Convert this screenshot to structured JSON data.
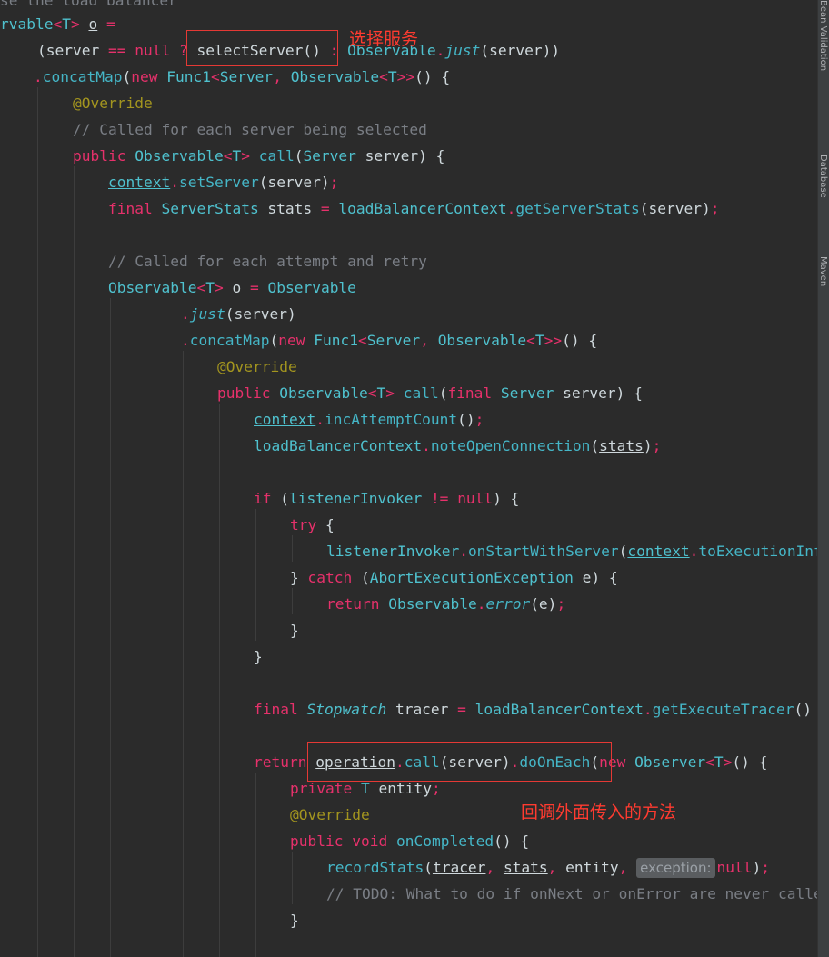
{
  "code_lines": [
    [
      [
        "cmt",
        "se the load balancer"
      ]
    ],
    [
      [
        "type",
        "rvable"
      ],
      [
        "op",
        "<"
      ],
      [
        "type",
        "T"
      ],
      [
        "op",
        ">"
      ],
      [
        "punct",
        " "
      ],
      [
        "ul",
        "o"
      ],
      [
        "punct",
        " "
      ],
      [
        "op",
        "="
      ]
    ],
    [
      [
        "punct",
        "(server "
      ],
      [
        "op",
        "=="
      ],
      [
        "punct",
        " "
      ],
      [
        "kw",
        "null"
      ],
      [
        "punct",
        " "
      ],
      [
        "op",
        "?"
      ],
      [
        "punct",
        " selectServer() "
      ],
      [
        "op",
        ":"
      ],
      [
        "punct",
        " "
      ],
      [
        "type",
        "Observable"
      ],
      [
        "op",
        "."
      ],
      [
        "ital",
        "just"
      ],
      [
        "punct",
        "(server))"
      ]
    ],
    [
      [
        "op",
        "."
      ],
      [
        "method",
        "concatMap"
      ],
      [
        "punct",
        "("
      ],
      [
        "kw",
        "new"
      ],
      [
        "punct",
        " "
      ],
      [
        "type",
        "Func1"
      ],
      [
        "op",
        "<"
      ],
      [
        "type",
        "Server"
      ],
      [
        "op",
        ","
      ],
      [
        "punct",
        " "
      ],
      [
        "type",
        "Observable"
      ],
      [
        "op",
        "<"
      ],
      [
        "type",
        "T"
      ],
      [
        "op",
        ">>"
      ],
      [
        "punct",
        "() {"
      ]
    ],
    [
      [
        "ann",
        "@Override"
      ]
    ],
    [
      [
        "cmt",
        "// Called for each server being selected"
      ]
    ],
    [
      [
        "kw",
        "public"
      ],
      [
        "punct",
        " "
      ],
      [
        "type",
        "Observable"
      ],
      [
        "op",
        "<"
      ],
      [
        "type",
        "T"
      ],
      [
        "op",
        ">"
      ],
      [
        "punct",
        " "
      ],
      [
        "method",
        "call"
      ],
      [
        "punct",
        "("
      ],
      [
        "type",
        "Server"
      ],
      [
        "punct",
        " server) {"
      ]
    ],
    [
      [
        "ulfield",
        "context"
      ],
      [
        "op",
        "."
      ],
      [
        "method",
        "setServer"
      ],
      [
        "punct",
        "(server)"
      ],
      [
        "op",
        ";"
      ]
    ],
    [
      [
        "kw",
        "final"
      ],
      [
        "punct",
        " "
      ],
      [
        "type",
        "ServerStats"
      ],
      [
        "punct",
        " stats "
      ],
      [
        "op",
        "="
      ],
      [
        "punct",
        " "
      ],
      [
        "field",
        "loadBalancerContext"
      ],
      [
        "op",
        "."
      ],
      [
        "method",
        "getServerStats"
      ],
      [
        "punct",
        "(server)"
      ],
      [
        "op",
        ";"
      ]
    ],
    [],
    [
      [
        "cmt",
        "// Called for each attempt and retry"
      ]
    ],
    [
      [
        "type",
        "Observable"
      ],
      [
        "op",
        "<"
      ],
      [
        "type",
        "T"
      ],
      [
        "op",
        ">"
      ],
      [
        "punct",
        " "
      ],
      [
        "ul",
        "o"
      ],
      [
        "punct",
        " "
      ],
      [
        "op",
        "="
      ],
      [
        "punct",
        " "
      ],
      [
        "type",
        "Observable"
      ]
    ],
    [
      [
        "op",
        "."
      ],
      [
        "ital",
        "just"
      ],
      [
        "punct",
        "(server)"
      ]
    ],
    [
      [
        "op",
        "."
      ],
      [
        "method",
        "concatMap"
      ],
      [
        "punct",
        "("
      ],
      [
        "kw",
        "new"
      ],
      [
        "punct",
        " "
      ],
      [
        "type",
        "Func1"
      ],
      [
        "op",
        "<"
      ],
      [
        "type",
        "Server"
      ],
      [
        "op",
        ","
      ],
      [
        "punct",
        " "
      ],
      [
        "type",
        "Observable"
      ],
      [
        "op",
        "<"
      ],
      [
        "type",
        "T"
      ],
      [
        "op",
        ">>"
      ],
      [
        "punct",
        "() {"
      ]
    ],
    [
      [
        "ann",
        "@Override"
      ]
    ],
    [
      [
        "kw",
        "public"
      ],
      [
        "punct",
        " "
      ],
      [
        "type",
        "Observable"
      ],
      [
        "op",
        "<"
      ],
      [
        "type",
        "T"
      ],
      [
        "op",
        ">"
      ],
      [
        "punct",
        " "
      ],
      [
        "method",
        "call"
      ],
      [
        "punct",
        "("
      ],
      [
        "kw",
        "final"
      ],
      [
        "punct",
        " "
      ],
      [
        "type",
        "Server"
      ],
      [
        "punct",
        " server) {"
      ]
    ],
    [
      [
        "ulfield",
        "context"
      ],
      [
        "op",
        "."
      ],
      [
        "method",
        "incAttemptCount"
      ],
      [
        "punct",
        "()"
      ],
      [
        "op",
        ";"
      ]
    ],
    [
      [
        "field",
        "loadBalancerContext"
      ],
      [
        "op",
        "."
      ],
      [
        "method",
        "noteOpenConnection"
      ],
      [
        "punct",
        "("
      ],
      [
        "ul",
        "stats"
      ],
      [
        "punct",
        ")"
      ],
      [
        "op",
        ";"
      ]
    ],
    [],
    [
      [
        "kw",
        "if"
      ],
      [
        "punct",
        " ("
      ],
      [
        "field",
        "listenerInvoker"
      ],
      [
        "punct",
        " "
      ],
      [
        "op",
        "!="
      ],
      [
        "punct",
        " "
      ],
      [
        "kw",
        "null"
      ],
      [
        "punct",
        ") {"
      ]
    ],
    [
      [
        "kw",
        "try"
      ],
      [
        "punct",
        " {"
      ]
    ],
    [
      [
        "field",
        "listenerInvoker"
      ],
      [
        "op",
        "."
      ],
      [
        "method",
        "onStartWithServer"
      ],
      [
        "punct",
        "("
      ],
      [
        "ulfield",
        "context"
      ],
      [
        "op",
        "."
      ],
      [
        "method",
        "toExecutionInfo"
      ]
    ],
    [
      [
        "punct",
        "} "
      ],
      [
        "kw",
        "catch"
      ],
      [
        "punct",
        " ("
      ],
      [
        "type",
        "AbortExecutionException"
      ],
      [
        "punct",
        " e) {"
      ]
    ],
    [
      [
        "kw",
        "return"
      ],
      [
        "punct",
        " "
      ],
      [
        "type",
        "Observable"
      ],
      [
        "op",
        "."
      ],
      [
        "ital",
        "error"
      ],
      [
        "punct",
        "(e)"
      ],
      [
        "op",
        ";"
      ]
    ],
    [
      [
        "punct",
        "}"
      ]
    ],
    [
      [
        "punct",
        "}"
      ]
    ],
    [],
    [
      [
        "kw",
        "final"
      ],
      [
        "punct",
        " "
      ],
      [
        "itype",
        "Stopwatch"
      ],
      [
        "punct",
        " tracer "
      ],
      [
        "op",
        "="
      ],
      [
        "punct",
        " "
      ],
      [
        "field",
        "loadBalancerContext"
      ],
      [
        "op",
        "."
      ],
      [
        "method",
        "getExecuteTracer"
      ],
      [
        "punct",
        "()"
      ]
    ],
    [],
    [
      [
        "kw",
        "return"
      ],
      [
        "punct",
        " "
      ],
      [
        "ul",
        "operation"
      ],
      [
        "op",
        "."
      ],
      [
        "method",
        "call"
      ],
      [
        "punct",
        "(server)"
      ],
      [
        "op",
        "."
      ],
      [
        "method",
        "doOnEach"
      ],
      [
        "punct",
        "("
      ],
      [
        "kw",
        "new"
      ],
      [
        "punct",
        " "
      ],
      [
        "type",
        "Observer"
      ],
      [
        "op",
        "<"
      ],
      [
        "type",
        "T"
      ],
      [
        "op",
        ">"
      ],
      [
        "punct",
        "() {"
      ]
    ],
    [
      [
        "kw",
        "private"
      ],
      [
        "punct",
        " "
      ],
      [
        "type",
        "T"
      ],
      [
        "punct",
        " entity"
      ],
      [
        "op",
        ";"
      ]
    ],
    [
      [
        "ann",
        "@Override"
      ]
    ],
    [
      [
        "kw",
        "public"
      ],
      [
        "punct",
        " "
      ],
      [
        "kw",
        "void"
      ],
      [
        "punct",
        " "
      ],
      [
        "method",
        "onCompleted"
      ],
      [
        "punct",
        "() {"
      ]
    ],
    [
      [
        "method",
        "recordStats"
      ],
      [
        "punct",
        "("
      ],
      [
        "ul",
        "tracer"
      ],
      [
        "op",
        ","
      ],
      [
        "punct",
        " "
      ],
      [
        "ul",
        "stats"
      ],
      [
        "op",
        ","
      ],
      [
        "punct",
        " entity"
      ],
      [
        "op",
        ","
      ],
      [
        "punct",
        " "
      ],
      [
        "hint",
        "exception:"
      ],
      [
        "kw",
        "null"
      ],
      [
        "punct",
        ")"
      ],
      [
        "op",
        ";"
      ]
    ],
    [
      [
        "cmt",
        "// TODO: What to do if onNext or onError are never called"
      ]
    ],
    [
      [
        "punct",
        "}"
      ]
    ]
  ],
  "annotations": {
    "select_server_label": "选择服务",
    "callback_label": "回调外面传入的方法"
  },
  "right_panel": {
    "tabs": [
      "Bean Validation",
      "Database",
      "Maven"
    ]
  },
  "colors": {
    "background": "#2b2b2b",
    "keyword": "#e6316b",
    "type": "#4fc1ce",
    "annotation": "#a3951f",
    "comment": "#7a7e85",
    "highlight_box": "#e53935"
  }
}
